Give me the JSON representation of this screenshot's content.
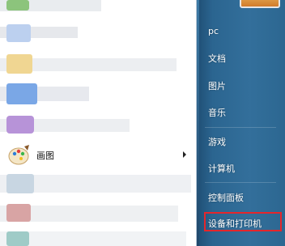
{
  "left_items": [
    {
      "icon": "paint-icon",
      "label": "画图",
      "has_arrow": true
    }
  ],
  "right_items": [
    {
      "label": "pc"
    },
    {
      "label": "文档"
    },
    {
      "label": "图片"
    },
    {
      "label": "音乐"
    },
    {
      "label": "游戏"
    },
    {
      "label": "计算机"
    },
    {
      "label": "控制面板"
    },
    {
      "label": "设备和打印机"
    }
  ],
  "colors": {
    "highlight": "#e5262b",
    "right_pane": "#2b6590"
  }
}
